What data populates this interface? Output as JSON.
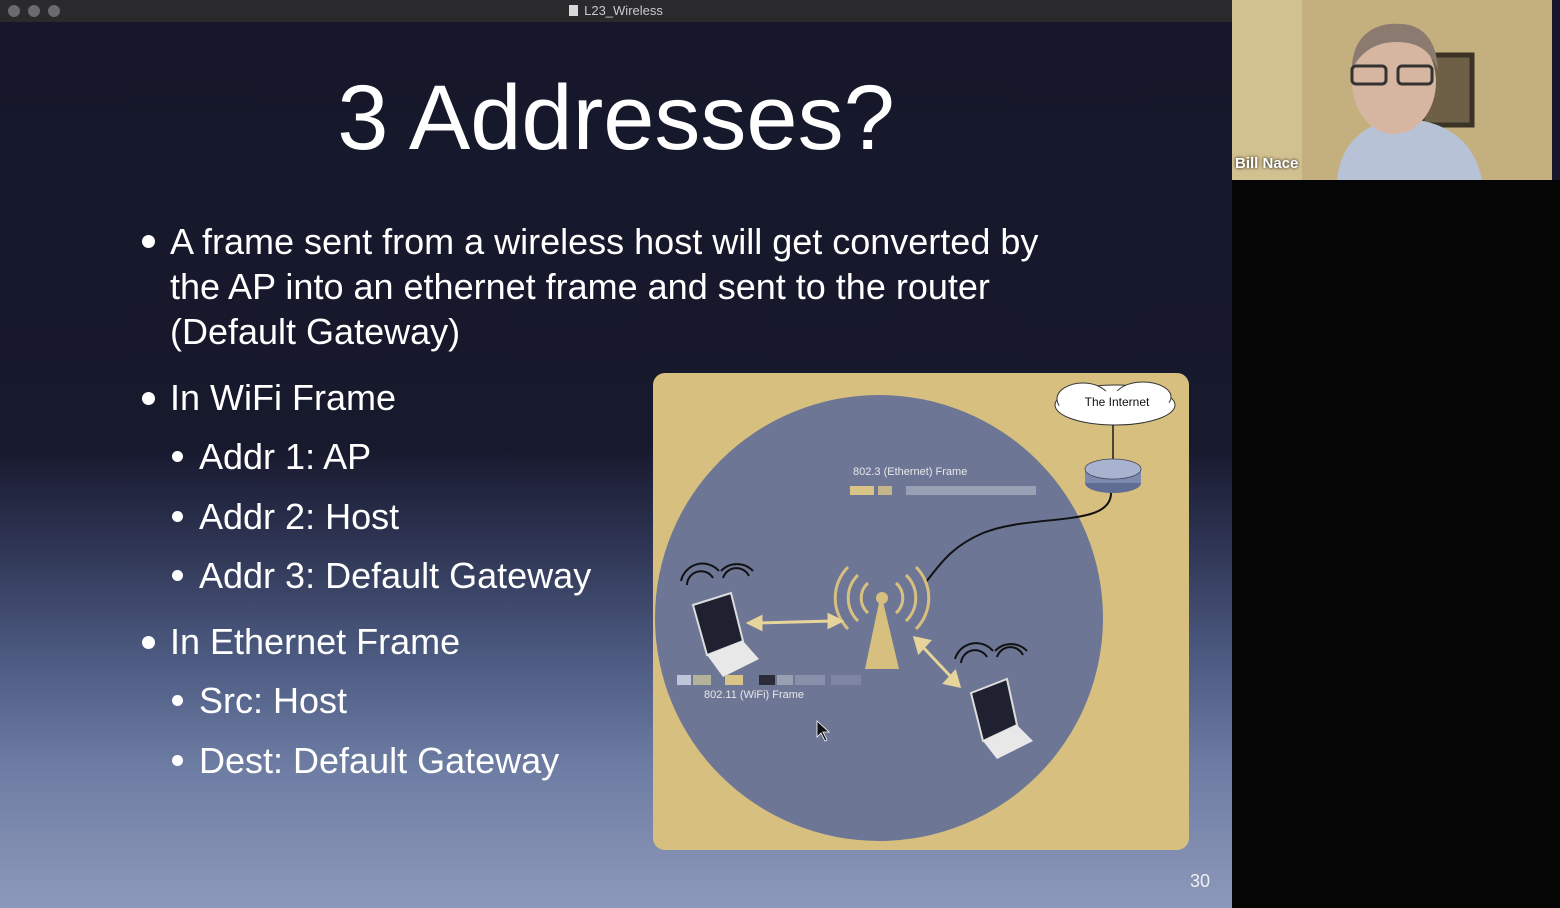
{
  "window": {
    "title": "L23_Wireless"
  },
  "slide": {
    "title": "3 Addresses?",
    "bullets": {
      "b1": "A frame sent from a wireless host will get converted by",
      "b1_line2": "the AP into an ethernet frame and sent to the router",
      "b1_line3": "(Default Gateway)",
      "b2": "In WiFi Frame",
      "b2_items": [
        "Addr 1: AP",
        "Addr 2: Host",
        "Addr 3: Default Gateway"
      ],
      "b3": "In Ethernet Frame",
      "b3_items": [
        "Src: Host",
        "Dest: Default Gateway"
      ]
    },
    "figure": {
      "internet_label": "The Internet",
      "ethernet_frame_label": "802.3 (Ethernet) Frame",
      "wifi_frame_label": "802.11 (WiFi) Frame"
    },
    "page_number": "30"
  },
  "video": {
    "participant_name": "Bill Nace"
  },
  "colors": {
    "slide_bg": "#16172a",
    "figure_bg": "#d7c07f",
    "coverage_circle": "#6e7696",
    "arrow": "#e6d49a"
  }
}
